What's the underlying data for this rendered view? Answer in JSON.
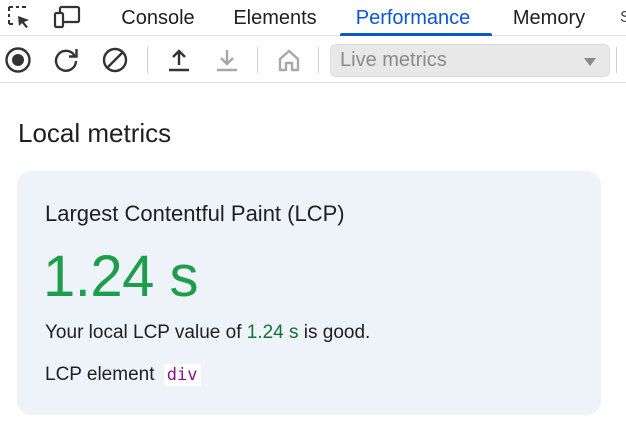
{
  "tabs": [
    {
      "label": "Console",
      "active": false
    },
    {
      "label": "Elements",
      "active": false
    },
    {
      "label": "Performance",
      "active": true
    },
    {
      "label": "Memory",
      "active": false
    }
  ],
  "tab_overflow": "S",
  "tabbar_icons": [
    "element-picker-icon",
    "device-toolbar-icon"
  ],
  "toolbar": {
    "icons": [
      "record-icon",
      "reload-record-icon",
      "clear-icon",
      "upload-icon",
      "download-icon",
      "home-icon",
      "chevron-down-icon"
    ],
    "select_label": "Live metrics"
  },
  "main": {
    "section_title": "Local metrics",
    "card": {
      "title": "Largest Contentful Paint (LCP)",
      "value": "1.24 s",
      "desc_prefix": "Your local LCP value of ",
      "desc_value": "1.24 s",
      "desc_suffix": " is good.",
      "element_label": "LCP element",
      "element_tag": "div"
    }
  },
  "colors": {
    "accent": "#0b57d0",
    "good_large": "#1e9d4b",
    "good_inline": "#137333",
    "card_bg": "#eef2f9",
    "tag": "#881280"
  }
}
